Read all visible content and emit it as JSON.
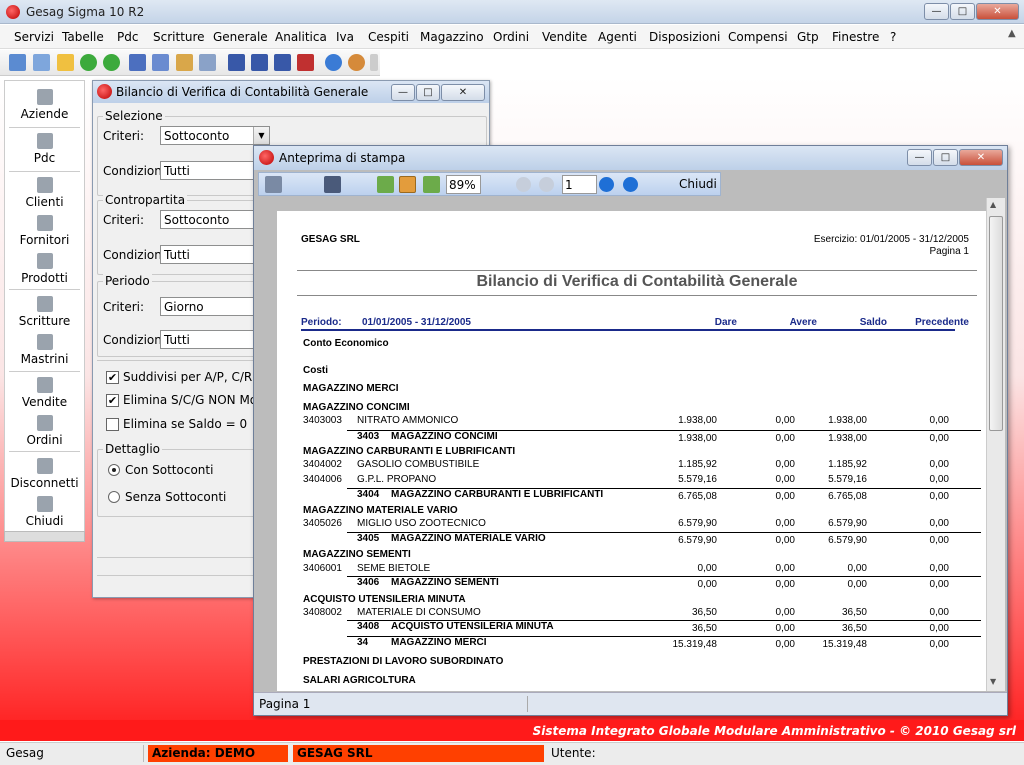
{
  "app": {
    "title": "Gesag Sigma 10 R2"
  },
  "menu": [
    "Servizi",
    "Tabelle",
    "Pdc",
    "Scritture",
    "Generale",
    "Analitica",
    "Iva",
    "Cespiti",
    "Magazzino",
    "Ordini",
    "Vendite",
    "Agenti",
    "Disposizioni",
    "Compensi",
    "Gtp",
    "Finestre",
    "?"
  ],
  "nav": [
    {
      "label": "Aziende",
      "icon": "aziende-icon"
    },
    {
      "label": "Pdc",
      "icon": "pdc-icon"
    },
    {
      "label": "Clienti",
      "icon": "clienti-icon"
    },
    {
      "label": "Fornitori",
      "icon": "fornitori-icon"
    },
    {
      "label": "Prodotti",
      "icon": "prodotti-icon"
    },
    {
      "label": "Scritture",
      "icon": "scritture-icon"
    },
    {
      "label": "Mastrini",
      "icon": "mastrini-icon"
    },
    {
      "label": "Vendite",
      "icon": "vendite-icon"
    },
    {
      "label": "Ordini",
      "icon": "ordini-icon"
    },
    {
      "label": "Disconnetti",
      "icon": "disconnetti-icon"
    },
    {
      "label": "Chiudi",
      "icon": "chiudi-icon"
    }
  ],
  "bil": {
    "title": "Bilancio di Verifica di Contabilità Generale",
    "selezione": {
      "title": "Selezione",
      "criteri_label": "Criteri:",
      "criteri": "Sottoconto",
      "condizioni_label": "Condizioni:",
      "condizioni": "Tutti"
    },
    "contropartita": {
      "title": "Contropartita",
      "criteri_label": "Criteri:",
      "criteri": "Sottoconto",
      "condizioni_label": "Condizioni:",
      "condizioni": "Tutti"
    },
    "periodo": {
      "title": "Periodo",
      "criteri_label": "Criteri:",
      "criteri": "Giorno",
      "condizioni_label": "Condizioni:",
      "condizioni": "Tutti"
    },
    "checks": [
      {
        "label": "Suddivisi per A/P, C/R",
        "checked": true
      },
      {
        "label": "Elimina S/C/G NON Movimen",
        "checked": true
      },
      {
        "label": "Elimina se Saldo = 0",
        "checked": false
      }
    ],
    "dettaglio": {
      "title": "Dettaglio",
      "opt1": "Con Sottoconti",
      "opt2": "Senza Sottoconti"
    }
  },
  "preview": {
    "title": "Anteprima di stampa",
    "zoom": "89%",
    "page_input": "1",
    "close_label": "Chiudi",
    "status": "Pagina 1"
  },
  "report": {
    "company": "GESAG SRL",
    "esercizio": "Esercizio: 01/01/2005 - 31/12/2005",
    "pagina": "Pagina 1",
    "title": "Bilancio di Verifica di Contabilità Generale",
    "periodo_label": "Periodo:",
    "periodo_value": "01/01/2005 - 31/12/2005",
    "col_dare": "Dare",
    "col_avere": "Avere",
    "col_saldo": "Saldo",
    "col_prec": "Precedente",
    "section1": "Conto Economico",
    "section2": "Costi",
    "rows": [
      {
        "t": "h",
        "text": "MAGAZZINO MERCI"
      },
      {
        "t": "h",
        "text": "MAGAZZINO CONCIMI"
      },
      {
        "t": "d",
        "code": "3403003",
        "text": "NITRATO AMMONICO",
        "dare": "1.938,00",
        "avere": "0,00",
        "saldo": "1.938,00",
        "prec": "0,00"
      },
      {
        "t": "s",
        "code": "3403",
        "text": "MAGAZZINO CONCIMI",
        "dare": "1.938,00",
        "avere": "0,00",
        "saldo": "1.938,00",
        "prec": "0,00"
      },
      {
        "t": "h",
        "text": "MAGAZZINO CARBURANTI E LUBRIFICANTI"
      },
      {
        "t": "d",
        "code": "3404002",
        "text": "GASOLIO COMBUSTIBILE",
        "dare": "1.185,92",
        "avere": "0,00",
        "saldo": "1.185,92",
        "prec": "0,00"
      },
      {
        "t": "d",
        "code": "3404006",
        "text": "G.P.L. PROPANO",
        "dare": "5.579,16",
        "avere": "0,00",
        "saldo": "5.579,16",
        "prec": "0,00"
      },
      {
        "t": "s",
        "code": "3404",
        "text": "MAGAZZINO CARBURANTI E LUBRIFICANTI",
        "dare": "6.765,08",
        "avere": "0,00",
        "saldo": "6.765,08",
        "prec": "0,00"
      },
      {
        "t": "h",
        "text": "MAGAZZINO MATERIALE VARIO"
      },
      {
        "t": "d",
        "code": "3405026",
        "text": "MIGLIO USO ZOOTECNICO",
        "dare": "6.579,90",
        "avere": "0,00",
        "saldo": "6.579,90",
        "prec": "0,00"
      },
      {
        "t": "s",
        "code": "3405",
        "text": "MAGAZZINO MATERIALE VARIO",
        "dare": "6.579,90",
        "avere": "0,00",
        "saldo": "6.579,90",
        "prec": "0,00"
      },
      {
        "t": "h",
        "text": "MAGAZZINO SEMENTI"
      },
      {
        "t": "d",
        "code": "3406001",
        "text": "SEME BIETOLE",
        "dare": "0,00",
        "avere": "0,00",
        "saldo": "0,00",
        "prec": "0,00"
      },
      {
        "t": "s",
        "code": "3406",
        "text": "MAGAZZINO SEMENTI",
        "dare": "0,00",
        "avere": "0,00",
        "saldo": "0,00",
        "prec": "0,00"
      },
      {
        "t": "h",
        "text": "ACQUISTO UTENSILERIA MINUTA"
      },
      {
        "t": "d",
        "code": "3408002",
        "text": "MATERIALE DI CONSUMO",
        "dare": "36,50",
        "avere": "0,00",
        "saldo": "36,50",
        "prec": "0,00"
      },
      {
        "t": "s",
        "code": "3408",
        "text": "ACQUISTO UTENSILERIA MINUTA",
        "dare": "36,50",
        "avere": "0,00",
        "saldo": "36,50",
        "prec": "0,00"
      },
      {
        "t": "s",
        "code": "34",
        "text": "MAGAZZINO MERCI",
        "dare": "15.319,48",
        "avere": "0,00",
        "saldo": "15.319,48",
        "prec": "0,00"
      },
      {
        "t": "h",
        "text": "PRESTAZIONI DI LAVORO SUBORDINATO"
      },
      {
        "t": "h",
        "text": "SALARI AGRICOLTURA"
      }
    ]
  },
  "footer": {
    "text": "Sistema Integrato Globale Modulare Amministrativo - © 2010 Gesag srl"
  },
  "statusbar": {
    "app": "Gesag",
    "azienda": "Azienda: DEMO",
    "company": "GESAG SRL",
    "utente": "Utente:"
  },
  "colors": {
    "accent_red": "#ff1a1a",
    "status_orange": "#ff4000"
  }
}
